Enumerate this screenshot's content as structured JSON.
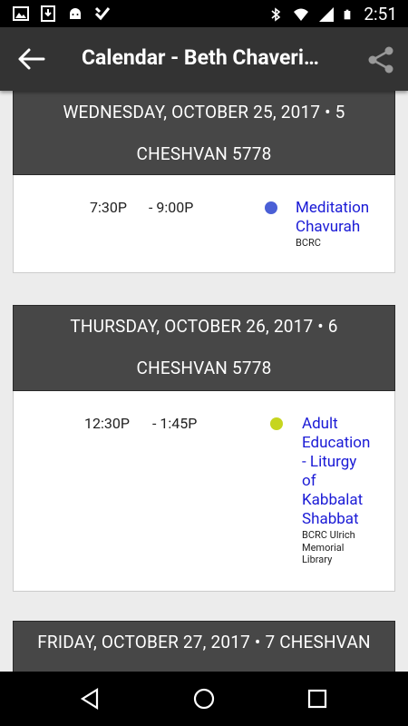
{
  "status_bar": {
    "time": "2:51",
    "left_icons": [
      "gallery-icon",
      "download-icon",
      "android-icon",
      "check-icon"
    ],
    "right_icons": [
      "bluetooth-icon",
      "wifi-icon",
      "signal-icon",
      "battery-icon"
    ]
  },
  "app_bar": {
    "title": "Calendar - Beth Chaveri…",
    "back_icon": "arrow-back-icon",
    "share_icon": "share-icon"
  },
  "days": [
    {
      "header_line1": "WEDNESDAY, OCTOBER 25, 2017  •  5",
      "header_line2": "CHESHVAN 5778",
      "events": [
        {
          "start": "7:30P",
          "end": "- 9:00P",
          "title": [
            "Meditation",
            "Chavurah"
          ],
          "location": [
            "BCRC"
          ],
          "color": "#4a5fd6"
        }
      ]
    },
    {
      "header_line1": "THURSDAY, OCTOBER 26, 2017  •  6",
      "header_line2": "CHESHVAN 5778",
      "events": [
        {
          "start": "12:30P",
          "end": "- 1:45P",
          "title": [
            "Adult",
            "Education",
            "- Liturgy",
            "of",
            "Kabbalat",
            "Shabbat"
          ],
          "location": [
            "BCRC Ulrich",
            "Memorial",
            "Library"
          ],
          "color": "#c6d51f"
        }
      ]
    },
    {
      "header_line1": "FRIDAY, OCTOBER 27, 2017  •  7 CHESHVAN",
      "header_line2": "",
      "events": []
    }
  ],
  "nav_bar": {
    "icons": [
      "back-triangle-icon",
      "home-circle-icon",
      "recents-square-icon"
    ]
  }
}
